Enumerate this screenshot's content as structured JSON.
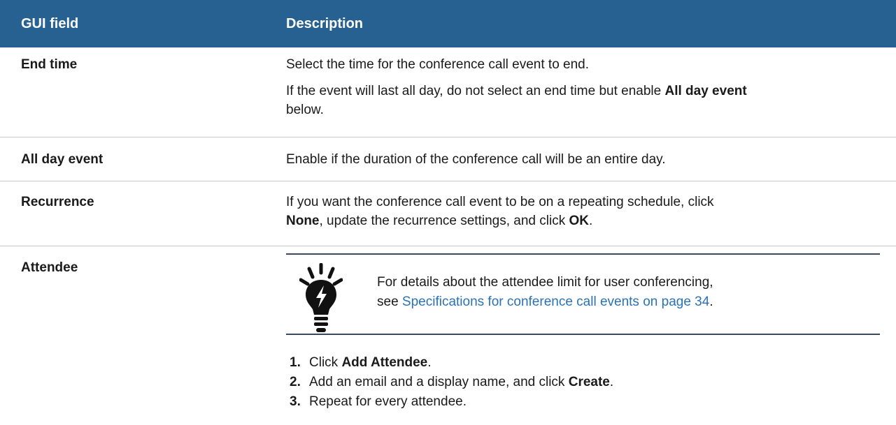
{
  "header": {
    "col1": "GUI field",
    "col2": "Description"
  },
  "rows": {
    "end_time": {
      "field": "End time",
      "line1": "Select the time for the conference call event to end.",
      "line2_pre": "If the event will last all day, do not select an end time but enable ",
      "line2_bold": "All day event",
      "line2_post": "below."
    },
    "all_day": {
      "field": "All day event",
      "desc": "Enable if the duration of the conference call will be an entire day."
    },
    "recurrence": {
      "field": "Recurrence",
      "pre": "If you want the conference call event to be on a repeating schedule, click ",
      "bold1": "None",
      "mid": ", update the recurrence settings, and click ",
      "bold2": "OK",
      "post": "."
    },
    "attendee": {
      "field": "Attendee",
      "note": {
        "icon": "lightbulb-tip-icon",
        "line1": "For details about the attendee limit for user conferencing,",
        "line2_pre": "see ",
        "link": "Specifications for conference call events on page 34",
        "line2_post": "."
      },
      "steps": [
        {
          "num": "1.",
          "pre": "Click ",
          "bold": "Add Attendee",
          "post": "."
        },
        {
          "num": "2.",
          "pre": "Add an email and a display name, and click ",
          "bold": "Create",
          "post": "."
        },
        {
          "num": "3.",
          "pre": "Repeat for every attendee.",
          "bold": "",
          "post": ""
        }
      ]
    }
  },
  "colors": {
    "header_bg": "#266191",
    "link": "#2a72b8"
  }
}
